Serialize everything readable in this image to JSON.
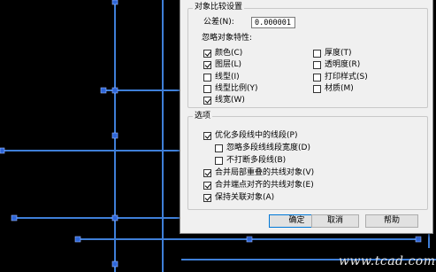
{
  "dialog": {
    "object_compare_group": {
      "title": "对象比较设置",
      "tolerance_label": "公差(N):",
      "tolerance_value": "0.000001",
      "ignore_props_label": "忽略对象特性:",
      "properties": [
        {
          "label": "颜色(C)",
          "checked": true
        },
        {
          "label": "图层(L)",
          "checked": true
        },
        {
          "label": "线型(I)",
          "checked": false
        },
        {
          "label": "线型比例(Y)",
          "checked": false
        },
        {
          "label": "线宽(W)",
          "checked": true
        },
        {
          "label": "厚度(T)",
          "checked": false
        },
        {
          "label": "透明度(R)",
          "checked": false
        },
        {
          "label": "打印样式(S)",
          "checked": false
        },
        {
          "label": "材质(M)",
          "checked": false
        }
      ]
    },
    "options_group": {
      "title": "选项",
      "items": [
        {
          "label": "优化多段线中的线段(P)",
          "checked": true
        },
        {
          "label": "忽略多段线线段宽度(D)",
          "checked": false
        },
        {
          "label": "不打断多段线(B)",
          "checked": false
        },
        {
          "label": "合并局部重叠的共线对象(V)",
          "checked": true
        },
        {
          "label": "合并端点对齐的共线对象(E)",
          "checked": true
        },
        {
          "label": "保持关联对象(A)",
          "checked": true
        }
      ]
    },
    "buttons": {
      "ok": "确定",
      "cancel": "取消",
      "help": "帮助"
    }
  },
  "watermark": "www.tcad.com",
  "colors": {
    "cad_line": "#3f7fd8",
    "cad_grip": "#2d66d9",
    "background": "#000000",
    "dialog_bg": "#f0f0f0"
  }
}
